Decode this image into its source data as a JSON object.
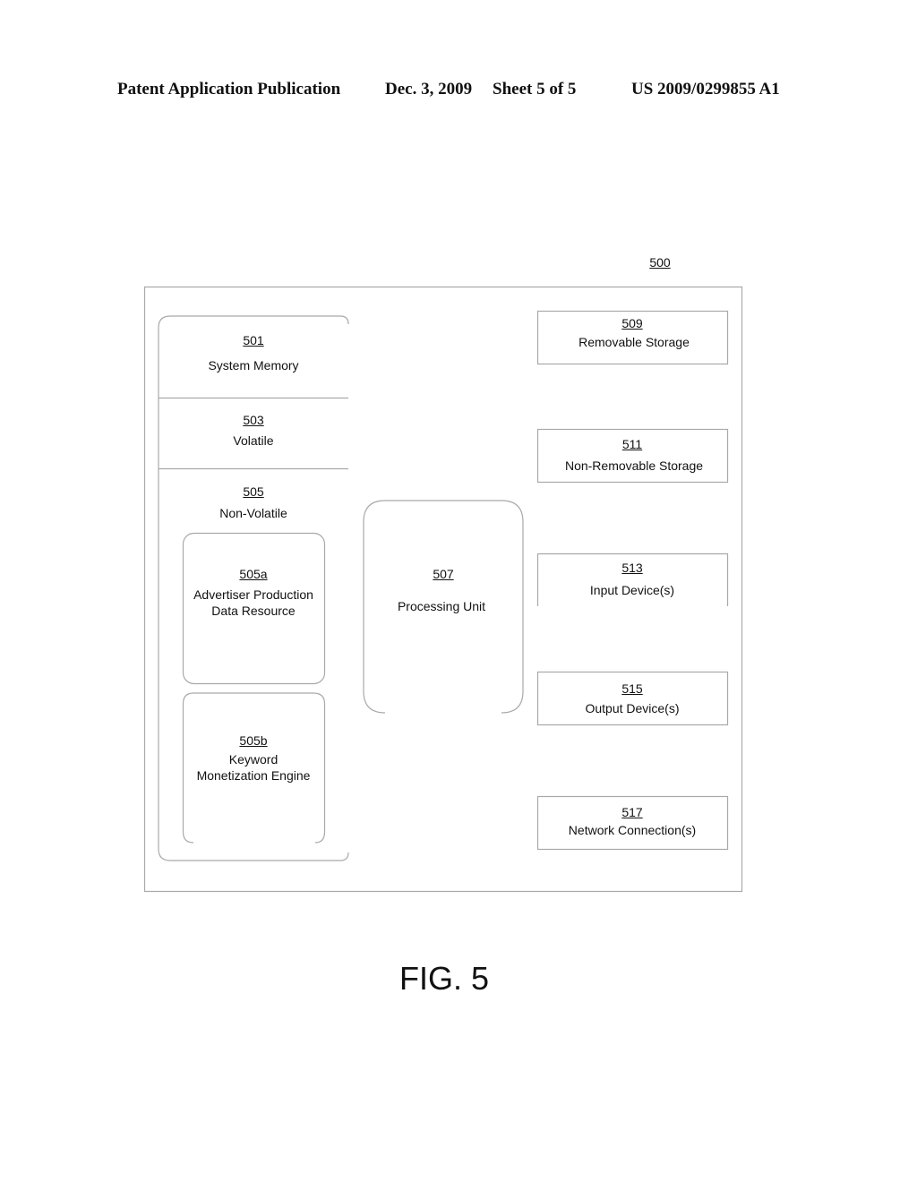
{
  "header": {
    "publication": "Patent Application Publication",
    "date": "Dec. 3, 2009",
    "sheet": "Sheet 5 of 5",
    "number": "US 2009/0299855 A1"
  },
  "diagram": {
    "ref": "500",
    "system_memory": {
      "num": "501",
      "label": "System Memory"
    },
    "volatile": {
      "num": "503",
      "label": "Volatile"
    },
    "non_volatile": {
      "num": "505",
      "label": "Non-Volatile"
    },
    "advertiser_data": {
      "num": "505a",
      "line1": "Advertiser Production",
      "line2": "Data Resource"
    },
    "keyword_engine": {
      "num": "505b",
      "line1": "Keyword",
      "line2": "Monetization Engine"
    },
    "processing_unit": {
      "num": "507",
      "label": "Processing Unit"
    },
    "removable_storage": {
      "num": "509",
      "label": "Removable Storage"
    },
    "non_removable_storage": {
      "num": "511",
      "label": "Non-Removable Storage"
    },
    "input_devices": {
      "num": "513",
      "label": "Input Device(s)"
    },
    "output_devices": {
      "num": "515",
      "label": "Output Device(s)"
    },
    "network_connections": {
      "num": "517",
      "label": "Network Connection(s)"
    }
  },
  "figure_label": "FIG. 5"
}
